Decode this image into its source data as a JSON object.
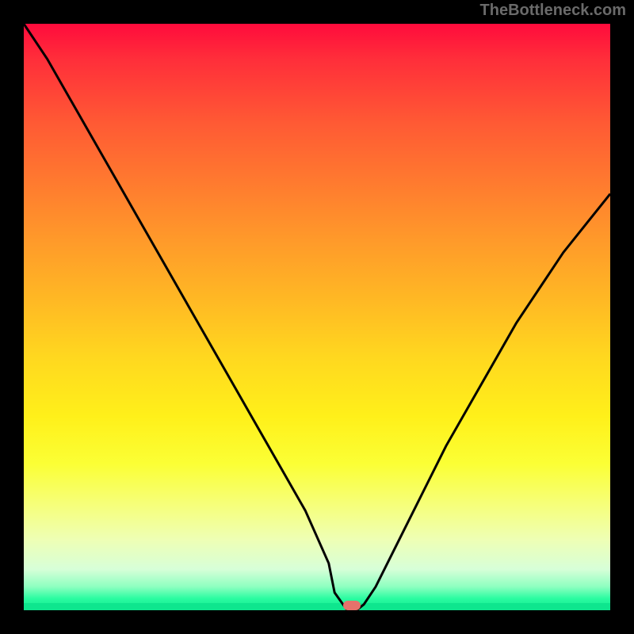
{
  "watermark": "TheBottleneck.com",
  "chart_data": {
    "type": "line",
    "title": "",
    "xlabel": "",
    "ylabel": "",
    "xlim": [
      0,
      100
    ],
    "ylim": [
      0,
      100
    ],
    "x": [
      0,
      4,
      8,
      12,
      16,
      20,
      24,
      28,
      32,
      36,
      40,
      44,
      48,
      52,
      53,
      55,
      57,
      58,
      60,
      64,
      68,
      72,
      76,
      80,
      84,
      88,
      92,
      96,
      100
    ],
    "values": [
      100,
      94,
      87,
      80,
      73,
      66,
      59,
      52,
      45,
      38,
      31,
      24,
      17,
      8,
      3,
      0.2,
      0.2,
      1,
      4,
      12,
      20,
      28,
      35,
      42,
      49,
      55,
      61,
      66,
      71
    ],
    "marker": {
      "x": 56,
      "y": 0.8
    },
    "colors": {
      "gradient_top": "#ff0b3c",
      "gradient_bottom": "#0ee68e",
      "curve": "#000000",
      "marker": "#e5726b",
      "frame": "#000000"
    }
  }
}
